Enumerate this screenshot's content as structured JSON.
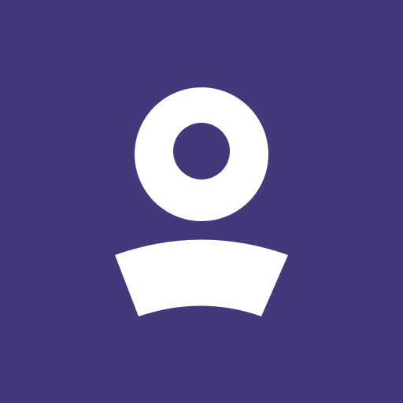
{
  "app_icon": {
    "icon": "user-profile-icon",
    "background_color": "#44377A",
    "foreground_color": "#FFFFFF"
  }
}
